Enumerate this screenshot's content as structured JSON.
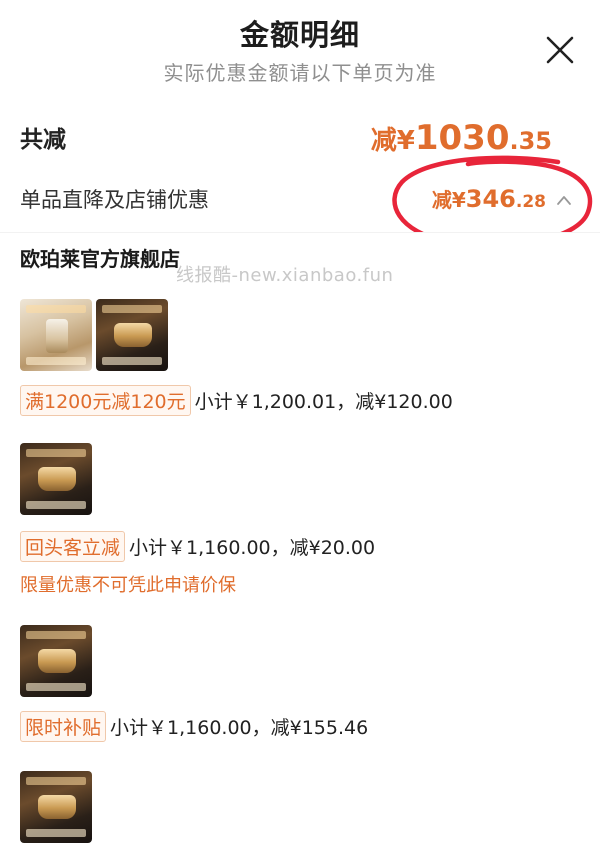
{
  "header": {
    "title": "金额明细",
    "subtitle": "实际优惠金额请以下单页为准"
  },
  "total": {
    "label": "共减",
    "prefix": "减¥",
    "integer": "1030",
    "decimal": ".35"
  },
  "item_discount": {
    "label": "单品直降及店铺优惠",
    "prefix": "减¥",
    "integer": "346",
    "decimal": ".28"
  },
  "store": {
    "name": "欧珀莱官方旗舰店"
  },
  "watermark": "线报酷-new.xianbao.fun",
  "promos": [
    {
      "tag": "满1200元减120元",
      "text": "小计￥1,200.01，减¥120.00",
      "note": ""
    },
    {
      "tag": "回头客立减",
      "text": "小计￥1,160.00，减¥20.00",
      "note": "限量优惠不可凭此申请价保"
    },
    {
      "tag": "限时补贴",
      "text": "小计￥1,160.00，减¥155.46",
      "note": ""
    }
  ],
  "colors": {
    "accent": "#e06d2d",
    "annotation_circle": "#e8253a"
  },
  "icons": {
    "close": "close-icon",
    "chevron": "chevron-up-icon"
  }
}
